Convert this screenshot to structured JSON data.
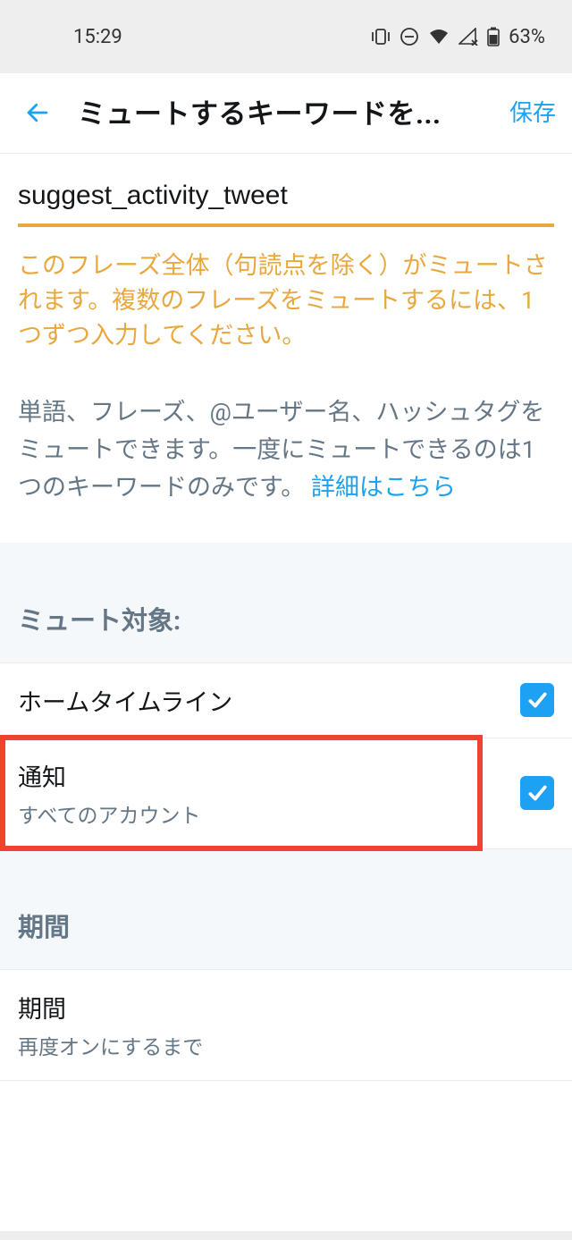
{
  "status_bar": {
    "time": "15:29",
    "battery": "63%"
  },
  "header": {
    "title": "ミュートするキーワードを...",
    "save_label": "保存"
  },
  "input": {
    "value": "suggest_activity_tweet",
    "warning": "このフレーズ全体（句読点を除く）がミュートされます。複数のフレーズをミュートするには、1つずつ入力してください。"
  },
  "help": {
    "text": "単語、フレーズ、@ユーザー名、ハッシュタグをミュートできます。一度にミュートできるのは1つのキーワードのみです。",
    "link_label": "詳細はこちら"
  },
  "sections": {
    "mute_target": {
      "header": "ミュート対象:",
      "items": [
        {
          "title": "ホームタイムライン",
          "subtitle": "",
          "checked": true
        },
        {
          "title": "通知",
          "subtitle": "すべてのアカウント",
          "checked": true
        }
      ]
    },
    "duration": {
      "header": "期間",
      "items": [
        {
          "title": "期間",
          "subtitle": "再度オンにするまで"
        }
      ]
    }
  }
}
